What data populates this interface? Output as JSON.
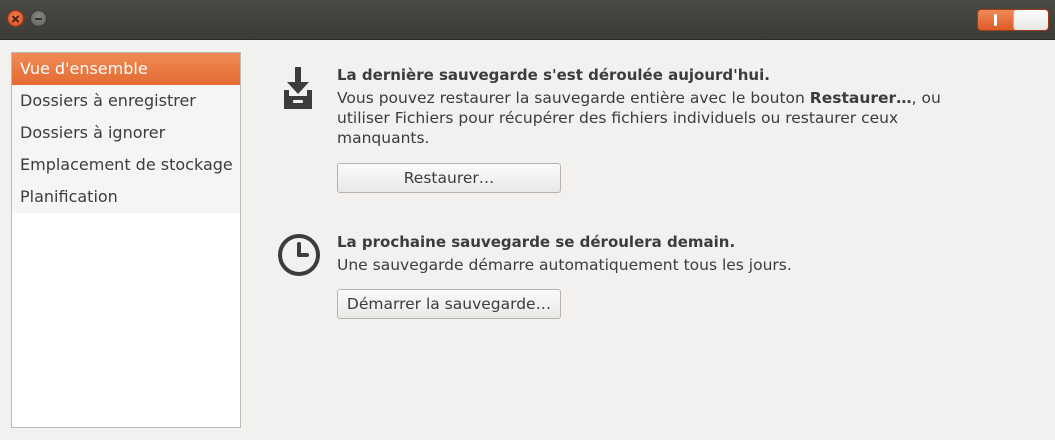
{
  "titlebar": {
    "close_icon": "close-icon",
    "minimize_icon": "minimize-icon",
    "toggle_state": "on"
  },
  "sidebar": {
    "items": [
      {
        "label": "Vue d'ensemble",
        "selected": true
      },
      {
        "label": "Dossiers à enregistrer",
        "selected": false
      },
      {
        "label": "Dossiers à ignorer",
        "selected": false
      },
      {
        "label": "Emplacement de stockage",
        "selected": false
      },
      {
        "label": "Planification",
        "selected": false
      }
    ]
  },
  "last_backup": {
    "icon": "download-tray-icon",
    "heading": "La dernière sauvegarde s'est déroulée aujourd'hui.",
    "desc_prefix": "Vous pouvez restaurer la sauvegarde entière avec le bouton ",
    "desc_bold": "Restaurer…",
    "desc_suffix": ", ou utiliser Fichiers pour récupérer des fichiers individuels ou restaurer ceux manquants.",
    "button_label": "Restaurer…"
  },
  "next_backup": {
    "icon": "clock-icon",
    "heading": "La prochaine sauvegarde se déroulera demain.",
    "desc": "Une sauvegarde démarre automatiquement tous les jours.",
    "button_label": "Démarrer la sauvegarde…"
  },
  "colors": {
    "accent": "#e46b33",
    "titlebar": "#3c3b37",
    "background": "#f2f1f0"
  }
}
